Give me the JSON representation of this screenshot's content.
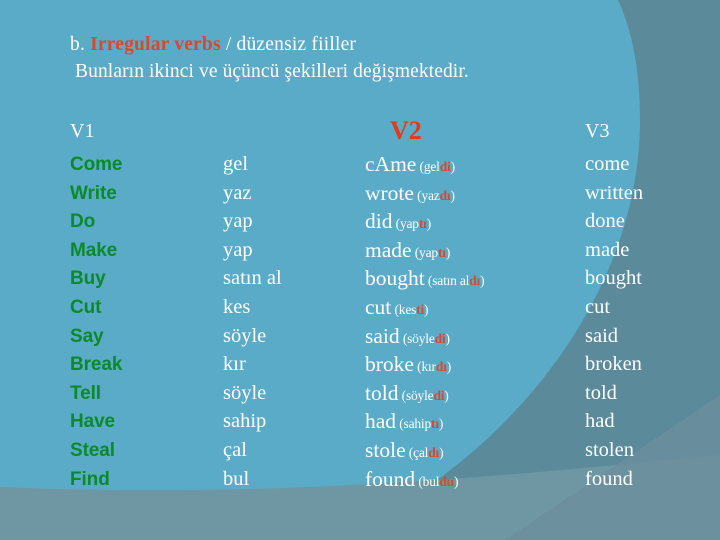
{
  "slide": {
    "background_color": "#5aabc8",
    "arc_color": "#5b8a9b",
    "band_color": "#6f97a3",
    "accent_red": "#d9482b",
    "accent_green": "#0b8a2a",
    "text_white": "#ffffff"
  },
  "heading": {
    "prefix": "b. ",
    "highlight": "Irregular verbs",
    "suffix": " / düzensiz fiiller",
    "line2": "Bunların ikinci ve üçüncü şekilleri değişmektedir."
  },
  "table": {
    "headers": {
      "v1": "V1",
      "v2": "V2",
      "v3": "V3"
    },
    "rows": [
      {
        "v1": "Come",
        "tr": "gel",
        "v2_base": "cAme",
        "v2_gloss_stem": "gel",
        "v2_gloss_suffix": "di",
        "v3": "come"
      },
      {
        "v1": "Write",
        "tr": "yaz",
        "v2_base": "wrote",
        "v2_gloss_stem": "yaz",
        "v2_gloss_suffix": "dı",
        "v3": "written"
      },
      {
        "v1": "Do",
        "tr": "yap",
        "v2_base": "did",
        "v2_gloss_stem": "yap",
        "v2_gloss_suffix": "tı",
        "v3": "done"
      },
      {
        "v1": "Make",
        "tr": "yap",
        "v2_base": "made",
        "v2_gloss_stem": "yap",
        "v2_gloss_suffix": "tı",
        "v3": "made"
      },
      {
        "v1": "Buy",
        "tr": "satın al",
        "v2_base": "bought",
        "v2_gloss_stem": "satın al",
        "v2_gloss_suffix": "dı",
        "v3": "bought"
      },
      {
        "v1": "Cut",
        "tr": "kes",
        "v2_base": "cut",
        "v2_gloss_stem": "kes",
        "v2_gloss_suffix": "ti",
        "v3": "cut"
      },
      {
        "v1": "Say",
        "tr": "söyle",
        "v2_base": "said",
        "v2_gloss_stem": "söyle",
        "v2_gloss_suffix": "di",
        "v3": "said"
      },
      {
        "v1": "Break",
        "tr": "kır",
        "v2_base": "broke",
        "v2_gloss_stem": "kır",
        "v2_gloss_suffix": "dı",
        "v3": "broken"
      },
      {
        "v1": "Tell",
        "tr": "söyle",
        "v2_base": "told",
        "v2_gloss_stem": "söyle",
        "v2_gloss_suffix": "di",
        "v3": "told"
      },
      {
        "v1": "Have",
        "tr": "sahip",
        "v2_base": "had",
        "v2_gloss_stem": "sahip",
        "v2_gloss_suffix": "tı",
        "v3": "had"
      },
      {
        "v1": "Steal",
        "tr": "çal",
        "v2_base": "stole",
        "v2_gloss_stem": "çal",
        "v2_gloss_suffix": "dı",
        "v3": "stolen"
      },
      {
        "v1": "Find",
        "tr": "bul",
        "v2_base": "found",
        "v2_gloss_stem": "bul",
        "v2_gloss_suffix": "du",
        "v3": "found"
      }
    ]
  }
}
